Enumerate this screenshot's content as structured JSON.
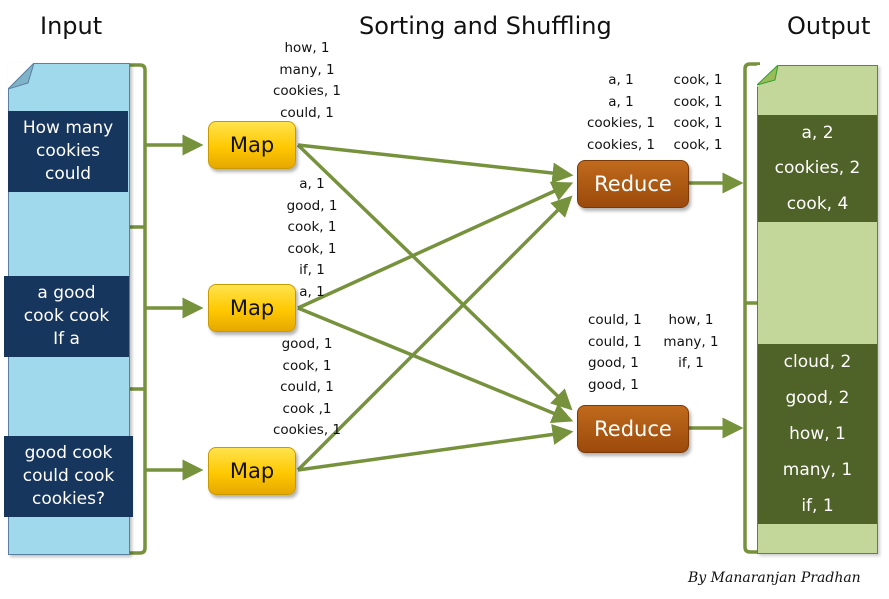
{
  "headers": {
    "input": "Input",
    "middle": "Sorting and Shuffling",
    "output": "Output"
  },
  "input_splits": [
    {
      "lines": [
        "How many",
        "cookies",
        "could"
      ]
    },
    {
      "lines": [
        "a good",
        "cook cook",
        "If a"
      ]
    },
    {
      "lines": [
        "good cook",
        "could cook",
        "cookies?"
      ]
    }
  ],
  "mappers": [
    {
      "label": "Map",
      "emits": [
        "how, 1",
        "many, 1",
        "cookies, 1",
        "could, 1"
      ]
    },
    {
      "label": "Map",
      "emits": [
        "a, 1",
        "good, 1",
        "cook, 1",
        "cook, 1",
        "if, 1",
        "a, 1"
      ]
    },
    {
      "label": "Map",
      "emits": [
        "good, 1",
        "cook, 1",
        "could, 1",
        "cook ,1",
        "cookies, 1"
      ]
    }
  ],
  "reducers": [
    {
      "label": "Reduce",
      "input_col1": [
        "a, 1",
        "a, 1",
        "cookies, 1",
        "cookies, 1"
      ],
      "input_col2": [
        "cook, 1",
        "cook, 1",
        "cook, 1",
        "cook, 1"
      ]
    },
    {
      "label": "Reduce",
      "input_col1": [
        "could, 1",
        "could, 1",
        "good, 1",
        "good, 1"
      ],
      "input_col2": [
        "how, 1",
        "many, 1",
        "if, 1"
      ]
    }
  ],
  "outputs": [
    {
      "lines": [
        "a, 2",
        "cookies, 2",
        "cook, 4"
      ]
    },
    {
      "lines": [
        "cloud, 2",
        "good, 2",
        "how, 1",
        "many, 1",
        "if, 1"
      ]
    }
  ],
  "credit": "By Manaranjan Pradhan",
  "colors": {
    "arrow": "#76923c",
    "input_doc": "#a0d9ec",
    "input_block": "#17365d",
    "output_doc": "#c4d79b",
    "output_block": "#4f6228",
    "map_fill": "#ffc800",
    "reduce_fill": "#a5520f"
  }
}
